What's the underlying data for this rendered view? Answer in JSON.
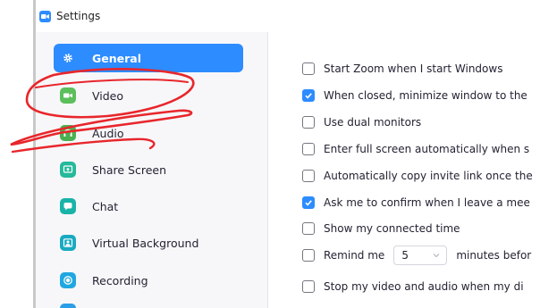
{
  "window": {
    "title": "Settings"
  },
  "sidebar": {
    "items": [
      {
        "label": "General",
        "icon": "gear-icon",
        "icon_color": "#ffffff",
        "active": true
      },
      {
        "label": "Video",
        "icon": "video-camera-icon",
        "icon_color": "#5bbf5b",
        "active": false
      },
      {
        "label": "Audio",
        "icon": "headphones-icon",
        "icon_color": "#4caf50",
        "active": false
      },
      {
        "label": "Share Screen",
        "icon": "share-screen-icon",
        "icon_color": "#26b99a",
        "active": false
      },
      {
        "label": "Chat",
        "icon": "chat-bubble-icon",
        "icon_color": "#19b3a8",
        "active": false
      },
      {
        "label": "Virtual Background",
        "icon": "virtual-background-icon",
        "icon_color": "#18aac0",
        "active": false
      },
      {
        "label": "Recording",
        "icon": "record-icon",
        "icon_color": "#21a7e0",
        "active": false
      }
    ]
  },
  "general": {
    "options": [
      {
        "label": "Start Zoom when I start Windows",
        "checked": false
      },
      {
        "label": "When closed, minimize window to the",
        "checked": true
      },
      {
        "label": "Use dual monitors",
        "checked": false
      },
      {
        "label": "Enter full screen automatically when s",
        "checked": false
      },
      {
        "label": "Automatically copy invite link once the",
        "checked": false
      },
      {
        "label": "Ask me to confirm when I leave a mee",
        "checked": true
      },
      {
        "label": "Show my connected time",
        "checked": false
      }
    ],
    "remind": {
      "label_before": "Remind me",
      "value": "5",
      "label_after": "minutes befor",
      "checked": false
    },
    "stop_video": {
      "label": "Stop my video and audio when my di",
      "checked": false
    }
  },
  "colors": {
    "accent": "#2d8cff",
    "sidebar_bg": "#f7f7fa",
    "annotation": "#e8262b"
  }
}
